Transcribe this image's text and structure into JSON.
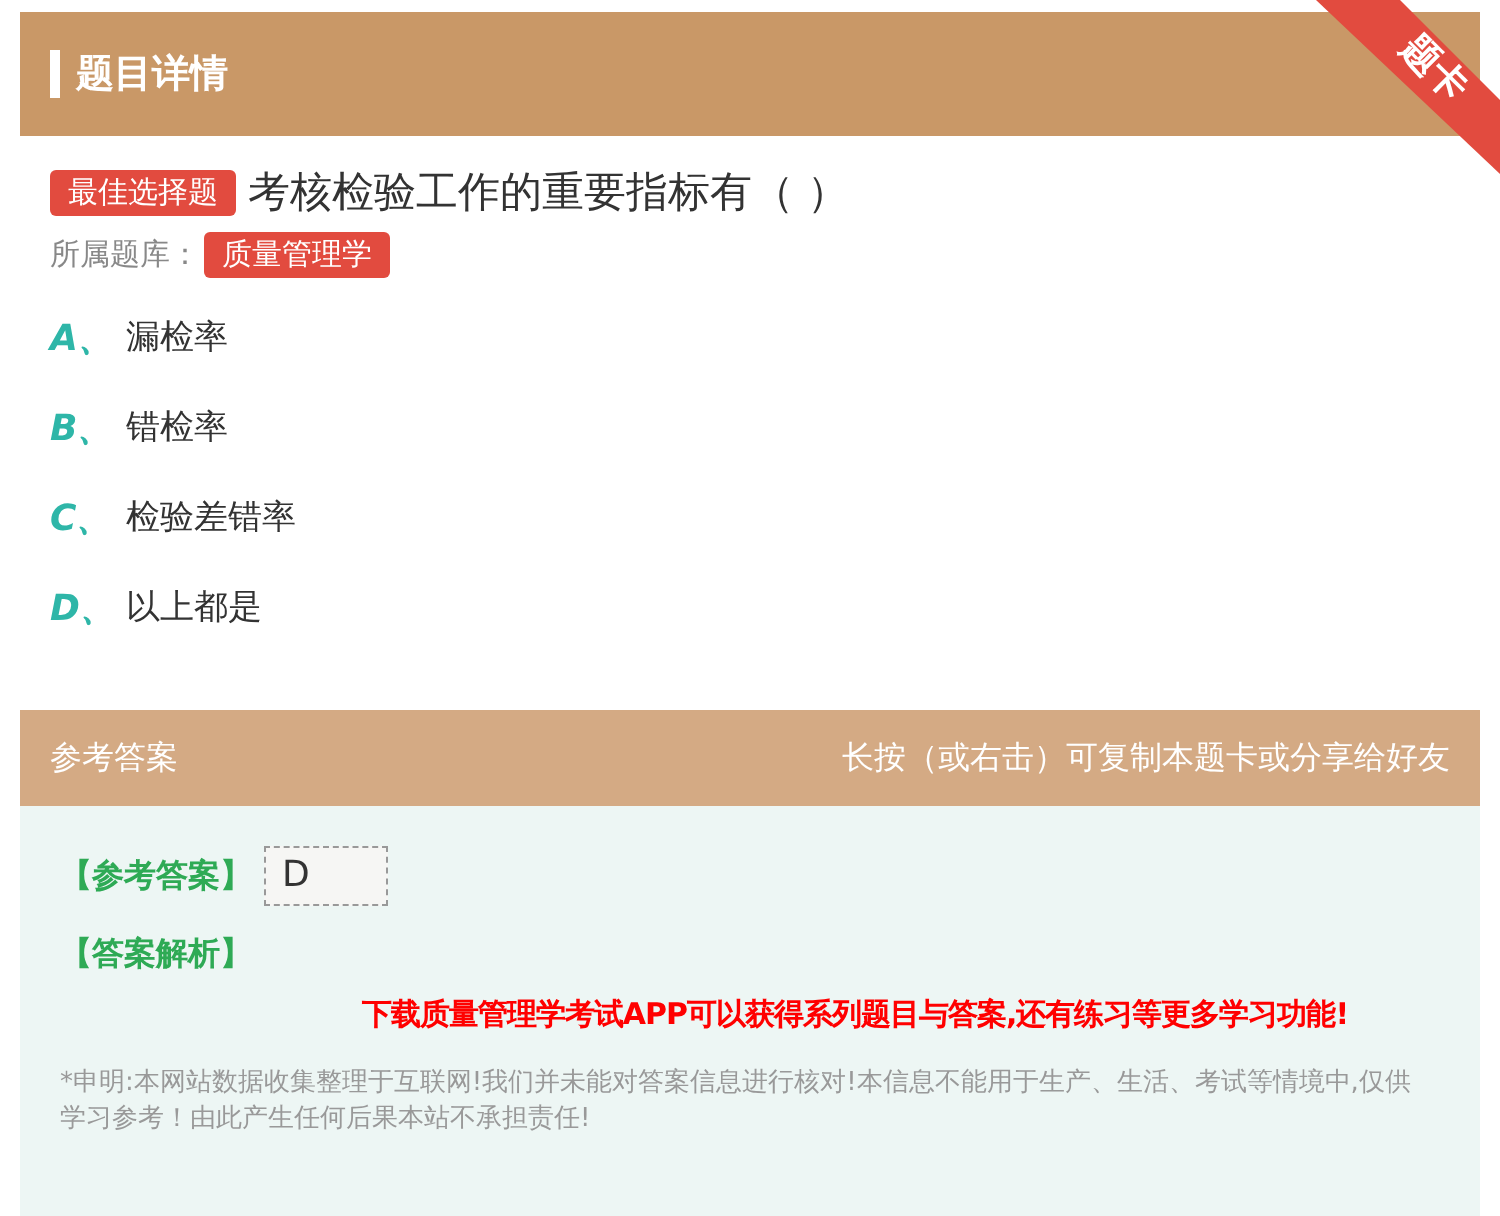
{
  "header": {
    "title": "题目详情",
    "ribbon": "题卡"
  },
  "question": {
    "type_badge": "最佳选择题",
    "text": "考核检验工作的重要指标有（ ）",
    "bank_label": "所属题库：",
    "bank": "质量管理学"
  },
  "options": [
    {
      "letter": "A、",
      "text": "漏检率"
    },
    {
      "letter": "B、",
      "text": "错检率"
    },
    {
      "letter": "C、",
      "text": "检验差错率"
    },
    {
      "letter": "D、",
      "text": "以上都是"
    }
  ],
  "answer_bar": {
    "title": "参考答案",
    "hint": "长按（或右击）可复制本题卡或分享给好友"
  },
  "answer": {
    "answer_label": "【参考答案】",
    "answer_value": "D",
    "analysis_label": "【答案解析】",
    "promo": "下载质量管理学考试APP可以获得系列题目与答案,还有练习等更多学习功能!",
    "disclaimer": "*申明:本网站数据收集整理于互联网!我们并未能对答案信息进行核对!本信息不能用于生产、生活、考试等情境中,仅供学习参考！由此产生任何后果本站不承担责任!"
  }
}
